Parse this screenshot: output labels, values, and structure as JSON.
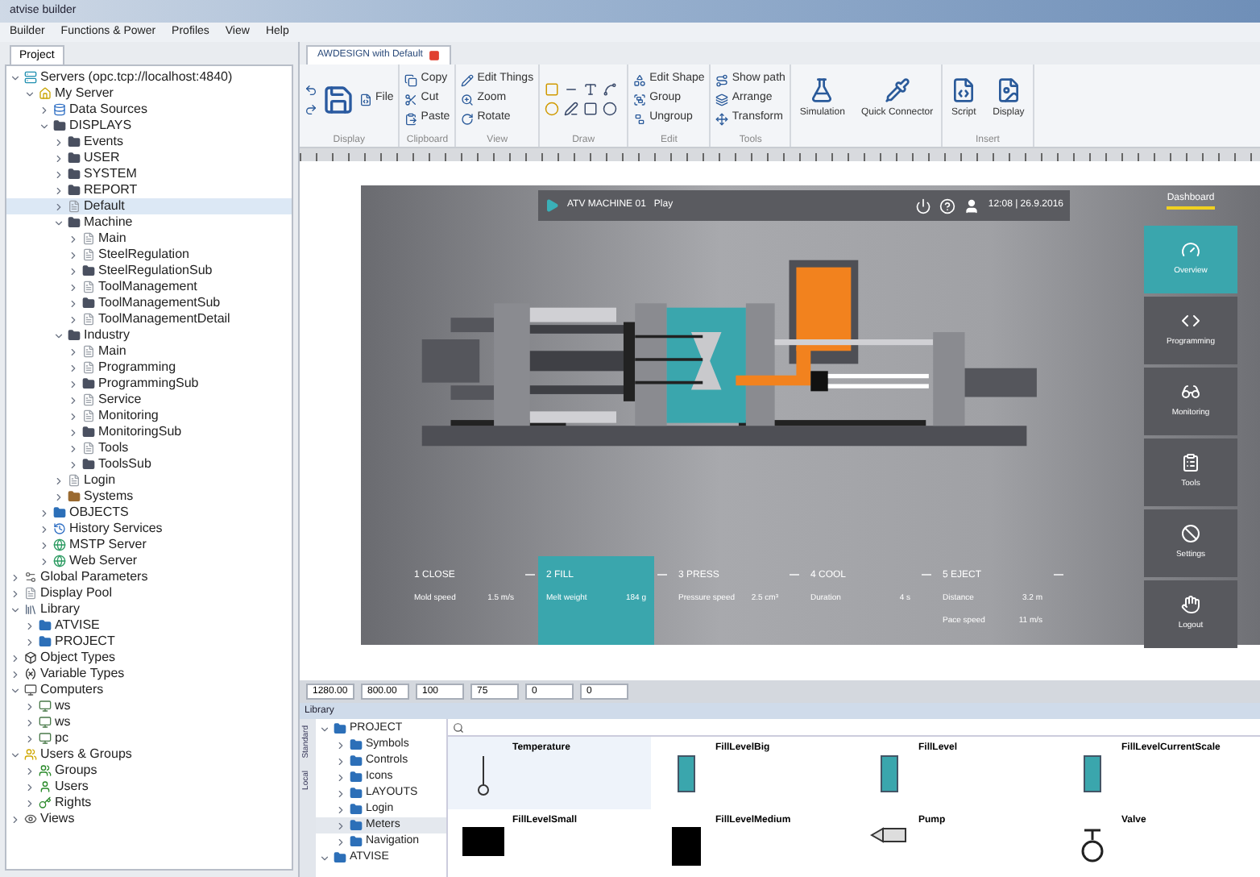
{
  "window": {
    "title": "atvise builder"
  },
  "menu": [
    "Builder",
    "Functions & Power",
    "Profiles",
    "View",
    "Help"
  ],
  "project_tab": {
    "label": "Project",
    "selected": true
  },
  "tree": [
    {
      "label": "Servers (opc.tcp://localhost:4840)",
      "kind": "server",
      "expanded": true,
      "selected": false,
      "children": [
        {
          "label": "My Server",
          "kind": "home",
          "expanded": true,
          "selected": false,
          "children": [
            {
              "label": "Data Sources",
              "kind": "source",
              "expanded": false,
              "selected": false
            },
            {
              "label": "DISPLAYS",
              "kind": "folder",
              "expanded": true,
              "selected": false,
              "children": [
                {
                  "label": "Events",
                  "kind": "folder",
                  "expanded": false,
                  "selected": false
                },
                {
                  "label": "USER",
                  "kind": "folder",
                  "expanded": false,
                  "selected": false
                },
                {
                  "label": "SYSTEM",
                  "kind": "folder",
                  "expanded": false,
                  "selected": false
                },
                {
                  "label": "REPORT",
                  "kind": "folder",
                  "expanded": false,
                  "selected": false
                },
                {
                  "label": "Default",
                  "kind": "page",
                  "expanded": false,
                  "selected": true
                },
                {
                  "label": "Machine",
                  "kind": "folder",
                  "expanded": true,
                  "selected": false,
                  "children": [
                    {
                      "label": "Main",
                      "kind": "page",
                      "expanded": false,
                      "selected": false
                    },
                    {
                      "label": "SteelRegulation",
                      "kind": "page",
                      "expanded": false,
                      "selected": false
                    },
                    {
                      "label": "SteelRegulationSub",
                      "kind": "folder",
                      "expanded": false,
                      "selected": false
                    },
                    {
                      "label": "ToolManagement",
                      "kind": "page",
                      "expanded": false,
                      "selected": false
                    },
                    {
                      "label": "ToolManagementSub",
                      "kind": "folder",
                      "expanded": false,
                      "selected": false
                    },
                    {
                      "label": "ToolManagementDetail",
                      "kind": "page",
                      "expanded": false,
                      "selected": false
                    }
                  ]
                },
                {
                  "label": "Industry",
                  "kind": "folder",
                  "expanded": true,
                  "selected": false,
                  "children": [
                    {
                      "label": "Main",
                      "kind": "page",
                      "expanded": false,
                      "selected": false
                    },
                    {
                      "label": "Programming",
                      "kind": "page",
                      "expanded": false,
                      "selected": false
                    },
                    {
                      "label": "ProgrammingSub",
                      "kind": "folder",
                      "expanded": false,
                      "selected": false
                    },
                    {
                      "label": "Service",
                      "kind": "page",
                      "expanded": false,
                      "selected": false
                    },
                    {
                      "label": "Monitoring",
                      "kind": "page",
                      "expanded": false,
                      "selected": false
                    },
                    {
                      "label": "MonitoringSub",
                      "kind": "folder",
                      "expanded": false,
                      "selected": false
                    },
                    {
                      "label": "Tools",
                      "kind": "page",
                      "expanded": false,
                      "selected": false
                    },
                    {
                      "label": "ToolsSub",
                      "kind": "folder",
                      "expanded": false,
                      "selected": false
                    }
                  ]
                },
                {
                  "label": "Login",
                  "kind": "page",
                  "expanded": false,
                  "selected": false
                },
                {
                  "label": "Systems",
                  "kind": "brown-folder",
                  "expanded": false,
                  "selected": false
                }
              ]
            },
            {
              "label": "OBJECTS",
              "kind": "blue-folder",
              "expanded": false,
              "selected": false
            },
            {
              "label": "History Services",
              "kind": "history",
              "expanded": false,
              "selected": false
            },
            {
              "label": "MSTP Server",
              "kind": "web",
              "expanded": false,
              "selected": false
            },
            {
              "label": "Web Server",
              "kind": "web",
              "expanded": false,
              "selected": false
            }
          ]
        }
      ]
    },
    {
      "label": "Global Parameters",
      "kind": "params",
      "expanded": false,
      "selected": false
    },
    {
      "label": "Display Pool",
      "kind": "page",
      "expanded": false,
      "selected": false
    },
    {
      "label": "Library",
      "kind": "library",
      "expanded": true,
      "selected": false,
      "children": [
        {
          "label": "ATVISE",
          "kind": "blue-folder",
          "expanded": false,
          "selected": false
        },
        {
          "label": "PROJECT",
          "kind": "blue-folder",
          "expanded": false,
          "selected": false
        }
      ]
    },
    {
      "label": "Object Types",
      "kind": "types",
      "expanded": false,
      "selected": false
    },
    {
      "label": "Variable Types",
      "kind": "vartype",
      "expanded": false,
      "selected": false
    },
    {
      "label": "Computers",
      "kind": "computer",
      "expanded": true,
      "selected": false,
      "children": [
        {
          "label": "ws",
          "kind": "pc",
          "expanded": false,
          "selected": false
        },
        {
          "label": "ws",
          "kind": "pc",
          "expanded": false,
          "selected": false
        },
        {
          "label": "pc",
          "kind": "pc",
          "expanded": false,
          "selected": false
        }
      ]
    },
    {
      "label": "Users & Groups",
      "kind": "users",
      "expanded": true,
      "selected": false,
      "children": [
        {
          "label": "Groups",
          "kind": "group",
          "expanded": false,
          "selected": false
        },
        {
          "label": "Users",
          "kind": "user",
          "expanded": false,
          "selected": false
        },
        {
          "label": "Rights",
          "kind": "key",
          "expanded": false,
          "selected": false
        }
      ]
    },
    {
      "label": "Views",
      "kind": "views",
      "expanded": false,
      "selected": false
    }
  ],
  "document_tab": {
    "label": "AWDESIGN with Default",
    "selected": true
  },
  "ribbon": [
    {
      "caption": "Display",
      "buttons": [
        {
          "label": "File",
          "kind": "small"
        }
      ]
    },
    {
      "caption": "Clipboard",
      "buttons": [
        {
          "label": "Copy",
          "kind": "small"
        },
        {
          "label": "Cut",
          "kind": "small"
        },
        {
          "label": "Paste",
          "kind": "small"
        }
      ]
    },
    {
      "caption": "View",
      "buttons": [
        {
          "label": "Edit Things",
          "kind": "small"
        },
        {
          "label": "Zoom",
          "kind": "small"
        },
        {
          "label": "Rotate",
          "kind": "small"
        }
      ]
    },
    {
      "caption": "Draw"
    },
    {
      "caption": "Edit",
      "buttons": [
        {
          "label": "Edit Shape",
          "kind": "small"
        },
        {
          "label": "Group",
          "kind": "small"
        },
        {
          "label": "Ungroup",
          "kind": "small"
        }
      ]
    },
    {
      "caption": "Tools",
      "buttons": [
        {
          "label": "Show path",
          "kind": "small"
        },
        {
          "label": "Arrange",
          "kind": "small"
        },
        {
          "label": "Transform",
          "kind": "small"
        }
      ]
    },
    {
      "buttons": [
        {
          "label": "Simulation",
          "kind": "large"
        },
        {
          "label": "Quick Connector",
          "kind": "large"
        }
      ]
    },
    {
      "caption": "Insert",
      "buttons": [
        {
          "label": "Script",
          "kind": "large"
        },
        {
          "label": "Display",
          "kind": "large"
        }
      ]
    }
  ],
  "hmi": {
    "machine_label": "ATV MACHINE 01",
    "mode": "Play",
    "datetime": "12:08 | 26.9.2016",
    "sidebar_title": "Dashboard",
    "nav": [
      {
        "label": "Overview",
        "selected": true
      },
      {
        "label": "Programming",
        "selected": false
      },
      {
        "label": "Monitoring",
        "selected": false
      },
      {
        "label": "Tools",
        "selected": false
      },
      {
        "label": "Settings",
        "selected": false
      },
      {
        "label": "Logout",
        "selected": false
      }
    ],
    "steps": [
      {
        "title": "1 CLOSE",
        "selected": false,
        "params": [
          {
            "label": "Mold speed",
            "value": "1.5 m/s"
          }
        ]
      },
      {
        "title": "2 FILL",
        "selected": true,
        "params": [
          {
            "label": "Melt weight",
            "value": "184 g"
          }
        ]
      },
      {
        "title": "3 PRESS",
        "selected": false,
        "params": [
          {
            "label": "Pressure speed",
            "value": "2.5 cm³"
          }
        ]
      },
      {
        "title": "4 COOL",
        "selected": false,
        "params": [
          {
            "label": "Duration",
            "value": "4 s"
          }
        ]
      },
      {
        "title": "5 EJECT",
        "selected": false,
        "params": [
          {
            "label": "Distance",
            "value": "3.2 m"
          },
          {
            "label": "Pace speed",
            "value": "11 m/s"
          }
        ]
      }
    ]
  },
  "status_fields": [
    "1280.00",
    "800.00",
    "100",
    "75",
    "0",
    "0"
  ],
  "library": {
    "title": "Library",
    "side_tabs": [
      "Standard",
      "Local"
    ],
    "tree": [
      {
        "label": "PROJECT",
        "expanded": true,
        "selected": false,
        "children": [
          {
            "label": "Symbols",
            "expanded": false,
            "selected": false
          },
          {
            "label": "Controls",
            "expanded": false,
            "selected": false
          },
          {
            "label": "Icons",
            "expanded": false,
            "selected": false
          },
          {
            "label": "LAYOUTS",
            "expanded": false,
            "selected": false
          },
          {
            "label": "Login",
            "expanded": false,
            "selected": false
          },
          {
            "label": "Meters",
            "expanded": false,
            "selected": true
          },
          {
            "label": "Navigation",
            "expanded": false,
            "selected": false
          }
        ]
      },
      {
        "label": "ATVISE",
        "expanded": true,
        "selected": false
      }
    ],
    "items": [
      {
        "name": "Temperature",
        "kind": "thermometer",
        "selected": true
      },
      {
        "name": "FillLevelBig",
        "kind": "tank",
        "selected": false
      },
      {
        "name": "FillLevel",
        "kind": "tank",
        "selected": false
      },
      {
        "name": "FillLevelCurrentScale",
        "kind": "tank",
        "selected": false
      },
      {
        "name": "FillLevelSmall",
        "kind": "black-block",
        "selected": false
      },
      {
        "name": "FillLevelMedium",
        "kind": "black-tank",
        "selected": false
      },
      {
        "name": "Pump",
        "kind": "pump",
        "selected": false
      },
      {
        "name": "Valve",
        "kind": "valve",
        "selected": false
      }
    ]
  }
}
